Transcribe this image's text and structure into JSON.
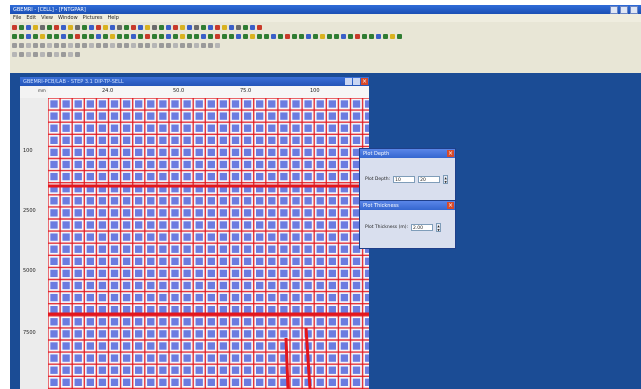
{
  "app": {
    "title": "GBEMRI - [CELL] - [FNTGPAR]",
    "menu": [
      "File",
      "Edit",
      "View",
      "Window",
      "Pictures",
      "Help"
    ]
  },
  "toolbar": {
    "row_colors": [
      [
        "#c83a2a",
        "#2f7d32",
        "#3a5fc8",
        "#d9b21f",
        "#6b6b6b",
        "#2f7d32",
        "#c83a2a",
        "#3a5fc8",
        "#d9b21f",
        "#6b6b6b",
        "#2f7d32",
        "#3a5fc8",
        "#c83a2a",
        "#d9b21f",
        "#3a5fc8",
        "#6b6b6b",
        "#2f7d32",
        "#c83a2a",
        "#3a5fc8",
        "#d9b21f",
        "#6b6b6b",
        "#2f7d32",
        "#3a5fc8",
        "#c83a2a",
        "#d9b21f",
        "#3a5fc8",
        "#6b6b6b",
        "#2f7d32",
        "#3a5fc8",
        "#c83a2a",
        "#d9b21f",
        "#3a5fc8",
        "#6b6b6b",
        "#2f7d32",
        "#3a5fc8",
        "#c83a2a"
      ],
      [
        "#2f7d32",
        "#2f7d32",
        "#3a5fc8",
        "#2f7d32",
        "#d9b21f",
        "#2f7d32",
        "#2f7d32",
        "#3a5fc8",
        "#2f7d32",
        "#c83a2a",
        "#2f7d32",
        "#2f7d32",
        "#3a5fc8",
        "#2f7d32",
        "#d9b21f",
        "#2f7d32",
        "#2f7d32",
        "#3a5fc8",
        "#2f7d32",
        "#c83a2a",
        "#2f7d32",
        "#2f7d32",
        "#3a5fc8",
        "#2f7d32",
        "#d9b21f",
        "#2f7d32",
        "#2f7d32",
        "#3a5fc8",
        "#2f7d32",
        "#c83a2a",
        "#2f7d32",
        "#2f7d32",
        "#3a5fc8",
        "#2f7d32",
        "#d9b21f",
        "#2f7d32",
        "#2f7d32",
        "#3a5fc8",
        "#2f7d32",
        "#c83a2a",
        "#2f7d32",
        "#2f7d32",
        "#3a5fc8",
        "#2f7d32",
        "#d9b21f",
        "#2f7d32",
        "#2f7d32",
        "#3a5fc8",
        "#2f7d32",
        "#c83a2a",
        "#2f7d32",
        "#2f7d32",
        "#3a5fc8",
        "#2f7d32",
        "#d9b21f",
        "#2f7d32"
      ],
      [
        "#9a9a9a",
        "#9a9a9a",
        "#b5b5b5",
        "#9a9a9a",
        "#9a9a9a",
        "#b5b5b5",
        "#9a9a9a",
        "#9a9a9a",
        "#b5b5b5",
        "#9a9a9a",
        "#9a9a9a",
        "#b5b5b5",
        "#9a9a9a",
        "#9a9a9a",
        "#b5b5b5",
        "#9a9a9a",
        "#9a9a9a",
        "#b5b5b5",
        "#9a9a9a",
        "#9a9a9a",
        "#b5b5b5",
        "#9a9a9a",
        "#9a9a9a",
        "#b5b5b5",
        "#9a9a9a",
        "#9a9a9a",
        "#b5b5b5",
        "#9a9a9a",
        "#9a9a9a",
        "#b5b5b5"
      ],
      [
        "#b5b5b5",
        "#9a9a9a",
        "#b5b5b5",
        "#9a9a9a",
        "#b5b5b5",
        "#9a9a9a",
        "#b5b5b5",
        "#9a9a9a",
        "#b5b5b5",
        "#9a9a9a"
      ]
    ]
  },
  "document": {
    "title": "GBEMRI-PCB/LAB - STEP 3.1 DIP-TP-SELL",
    "corner_label": "mm",
    "top_ruler_ticks": [
      "24.0",
      "50.0",
      "75.0",
      "100"
    ],
    "left_ruler_ticks": [
      "100",
      "2500",
      "5000",
      "7500"
    ]
  },
  "panels": {
    "plot_depth": {
      "title": "Plot Depth",
      "label": "Plot Depth:",
      "from_value": "10",
      "to_value": "20"
    },
    "plot_thickness": {
      "title": "Plot Thickness",
      "label": "Plot Thickness (m):",
      "value": "2.00"
    }
  },
  "colors": {
    "desktop_bg": "#1b4c95",
    "cell_fill": "#6b7ce0",
    "cell_edge": "#ffffff",
    "line_red": "#e3161c"
  }
}
